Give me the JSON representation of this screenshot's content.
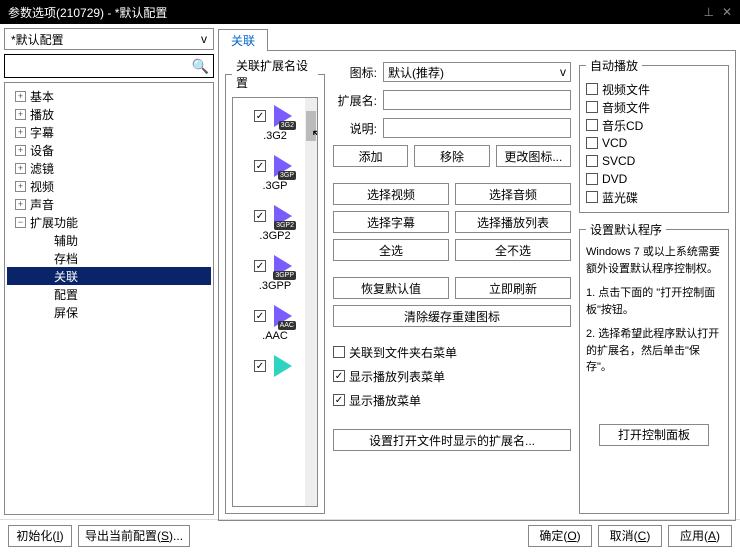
{
  "title": "参数选项(210729) - *默认配置",
  "config_dropdown": "*默认配置",
  "tree": [
    {
      "label": "基本",
      "expand": "+"
    },
    {
      "label": "播放",
      "expand": "+"
    },
    {
      "label": "字幕",
      "expand": "+"
    },
    {
      "label": "设备",
      "expand": "+"
    },
    {
      "label": "滤镜",
      "expand": "+"
    },
    {
      "label": "视频",
      "expand": "+"
    },
    {
      "label": "声音",
      "expand": "+"
    },
    {
      "label": "扩展功能",
      "expand": "−",
      "children": [
        {
          "label": "辅助"
        },
        {
          "label": "存档"
        },
        {
          "label": "关联",
          "selected": true
        },
        {
          "label": "配置"
        },
        {
          "label": "屏保"
        }
      ]
    }
  ],
  "tab_label": "关联",
  "ext_fieldset_title": "关联扩展名设置",
  "extensions": [
    {
      "label": ".3G2",
      "badge": "3G2",
      "color": "#7b5cff"
    },
    {
      "label": ".3GP",
      "badge": "3GP",
      "color": "#7b5cff"
    },
    {
      "label": ".3GP2",
      "badge": "3GP2",
      "color": "#7b5cff"
    },
    {
      "label": ".3GPP",
      "badge": "3GPP",
      "color": "#7b5cff"
    },
    {
      "label": ".AAC",
      "badge": "AAC",
      "color": "#7b5cff"
    },
    {
      "label": "",
      "badge": "",
      "color": "#2dd4bf"
    }
  ],
  "form": {
    "icon_label": "图标:",
    "icon_value": "默认(推荐)",
    "ext_label": "扩展名:",
    "desc_label": "说明:"
  },
  "buttons": {
    "add": "添加",
    "remove": "移除",
    "change_icon": "更改图标...",
    "sel_video": "选择视频",
    "sel_audio": "选择音频",
    "sel_sub": "选择字幕",
    "sel_playlist": "选择播放列表",
    "sel_all": "全选",
    "sel_none": "全不选",
    "restore": "恢复默认值",
    "refresh": "立即刷新",
    "clear_cache": "清除缓存重建图标",
    "set_ext_display": "设置打开文件时显示的扩展名..."
  },
  "checkboxes": {
    "context_menu": "关联到文件夹右菜单",
    "show_playlist_menu": "显示播放列表菜单",
    "show_play_menu": "显示播放菜单"
  },
  "autoplay": {
    "title": "自动播放",
    "items": [
      "视频文件",
      "音频文件",
      "音乐CD",
      "VCD",
      "SVCD",
      "DVD",
      "蓝光碟"
    ]
  },
  "default_program": {
    "title": "设置默认程序",
    "text1": "Windows 7 或以上系统需要额外设置默认程序控制权。",
    "text2": "1. 点击下面的 \"打开控制面板\"按钮。",
    "text3": "2. 选择希望此程序默认打开的扩展名，然后单击\"保存\"。",
    "button": "打开控制面板"
  },
  "footer": {
    "init": "初始化",
    "init_key": "I",
    "export": "导出当前配置",
    "export_key": "S",
    "ok": "确定",
    "ok_key": "O",
    "cancel": "取消",
    "cancel_key": "C",
    "apply": "应用",
    "apply_key": "A"
  }
}
